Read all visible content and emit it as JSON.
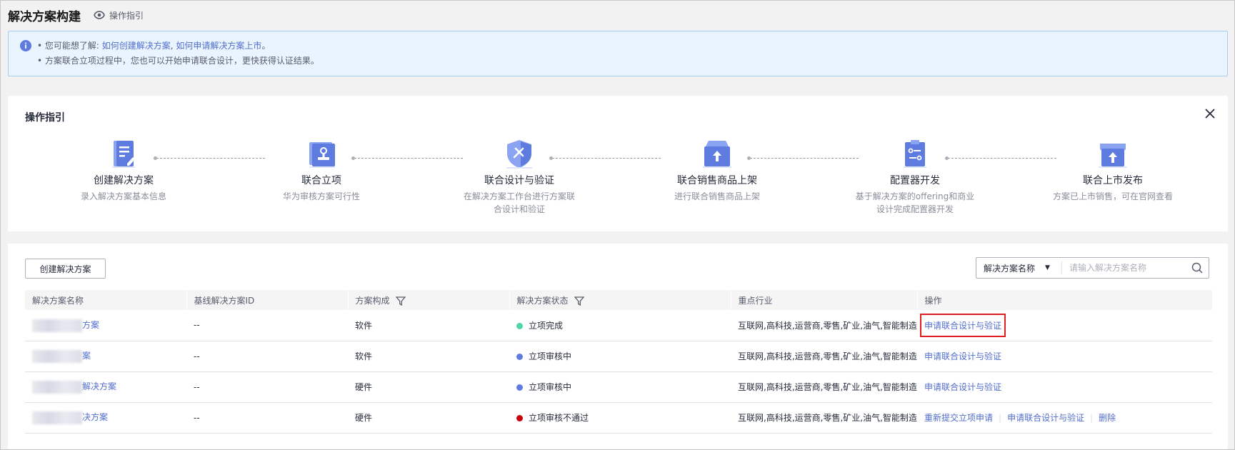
{
  "header": {
    "title": "解决方案构建",
    "guide_link": "操作指引"
  },
  "notice": {
    "line1_prefix": "• 您可能想了解: ",
    "line1_link1": "如何创建解决方案",
    "line1_sep": ", ",
    "line1_link2": "如何申请解决方案上市",
    "line1_suffix": "。",
    "line2": "• 方案联合立项过程中，您也可以开始申请联合设计，更快获得认证结果。"
  },
  "guide": {
    "title": "操作指引",
    "steps": [
      {
        "title": "创建解决方案",
        "desc": "录入解决方案基本信息",
        "icon": "document-edit-icon"
      },
      {
        "title": "联合立项",
        "desc": "华为审核方案可行性",
        "icon": "stamp-icon"
      },
      {
        "title": "联合设计与验证",
        "desc": "在解决方案工作台进行方案联合设计和验证",
        "icon": "shield-tools-icon"
      },
      {
        "title": "联合销售商品上架",
        "desc": "进行联合销售商品上架",
        "icon": "box-upload-icon"
      },
      {
        "title": "配置器开发",
        "desc": "基于解决方案的offering和商业设计完成配置器开发",
        "icon": "config-document-icon"
      },
      {
        "title": "联合上市发布",
        "desc": "方案已上市销售，可在官网查看",
        "icon": "store-upload-icon"
      }
    ]
  },
  "toolbar": {
    "create_label": "创建解决方案",
    "search_field": "解决方案名称",
    "search_placeholder": "请输入解决方案名称"
  },
  "table": {
    "columns": [
      "解决方案名称",
      "基线解决方案ID",
      "方案构成",
      "解决方案状态",
      "重点行业",
      "操作"
    ],
    "rows": [
      {
        "name_suffix": "方案",
        "baseline_id": "--",
        "composition": "软件",
        "status": "立项完成",
        "status_color": "#50d4ab",
        "industry": "互联网,高科技,运营商,零售,矿业,油气,智能制造,...",
        "ops": [
          "申请联合设计与验证"
        ]
      },
      {
        "name_suffix": "案",
        "baseline_id": "--",
        "composition": "软件",
        "status": "立项审核中",
        "status_color": "#5e7ce0",
        "industry": "互联网,高科技,运营商,零售,矿业,油气,智能制造,...",
        "ops": [
          "申请联合设计与验证"
        ]
      },
      {
        "name_suffix": "解决方案",
        "baseline_id": "--",
        "composition": "硬件",
        "status": "立项审核中",
        "status_color": "#5e7ce0",
        "industry": "互联网,高科技,运营商,零售,矿业,油气,智能制造,...",
        "ops": [
          "申请联合设计与验证"
        ]
      },
      {
        "name_suffix": "决方案",
        "baseline_id": "--",
        "composition": "硬件",
        "status": "立项审核不通过",
        "status_color": "#c7000b",
        "industry": "互联网,高科技,运营商,零售,矿业,油气,智能制造,...",
        "ops": [
          "重新提交立项申请",
          "申请联合设计与验证",
          "删除"
        ]
      }
    ]
  }
}
